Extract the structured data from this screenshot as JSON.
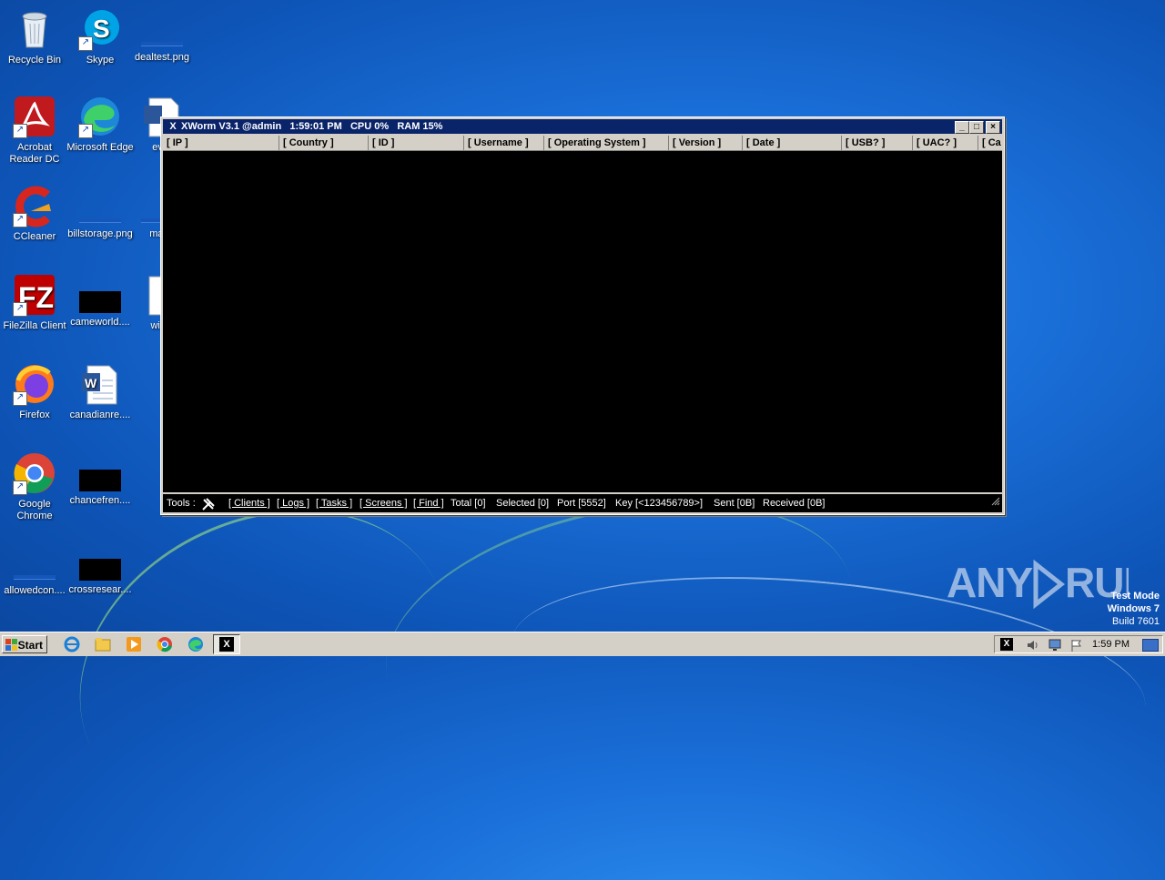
{
  "desktop": {
    "icons": [
      {
        "label": "Recycle Bin",
        "icon": "recycle-bin-icon"
      },
      {
        "label": "Skype",
        "icon": "skype-icon"
      },
      {
        "label": "dealtest.png",
        "icon": "image-file-icon"
      },
      {
        "label": "Acrobat Reader DC",
        "icon": "acrobat-icon"
      },
      {
        "label": "Microsoft Edge",
        "icon": "edge-icon"
      },
      {
        "label": "ever",
        "icon": "word-doc-icon"
      },
      {
        "label": "CCleaner",
        "icon": "ccleaner-icon"
      },
      {
        "label": "billstorage.png",
        "icon": "image-file-icon"
      },
      {
        "label": "manu",
        "icon": "word-doc-icon"
      },
      {
        "label": "FileZilla Client",
        "icon": "filezilla-icon"
      },
      {
        "label": "cameworld....",
        "icon": "image-file-icon"
      },
      {
        "label": "withs",
        "icon": "word-doc-icon"
      },
      {
        "label": "Firefox",
        "icon": "firefox-icon"
      },
      {
        "label": "canadianre....",
        "icon": "word-doc-icon"
      },
      {
        "label": "Google Chrome",
        "icon": "chrome-icon"
      },
      {
        "label": "chancefren....",
        "icon": "image-file-icon"
      },
      {
        "label": "allowedcon....",
        "icon": "image-file-icon"
      },
      {
        "label": "crossresear....",
        "icon": "image-file-icon"
      }
    ]
  },
  "window": {
    "title": "XWorm V3.1 @admin   1:59:01 PM   CPU 0%   RAM 15%",
    "app_icon": "X",
    "columns": [
      "[ IP ]",
      "[ Country ]",
      "[ ID ]",
      "[ Username ]",
      "[ Operating System ]",
      "[ Version ]",
      "[ Date ]",
      "[ USB? ]",
      "[ UAC? ]",
      "[ Ca"
    ],
    "status": {
      "tools_label": "Tools :",
      "clients": "[ Clients ]",
      "logs": "[ Logs ]",
      "tasks": "[ Tasks ]",
      "screens": "[ Screens ]",
      "find": "[ Find ]",
      "total": "Total [0]",
      "selected": "Selected [0]",
      "port": "Port [5552]",
      "key": "Key [<123456789>]",
      "sent": "Sent [0B]",
      "received": "Received [0B]"
    }
  },
  "watermark": {
    "text": "ANY RUN",
    "test_mode": "Test Mode",
    "os": "Windows 7",
    "build": "Build 7601"
  },
  "taskbar": {
    "start_label": "Start",
    "clock": "1:59 PM",
    "active_app": "X"
  }
}
